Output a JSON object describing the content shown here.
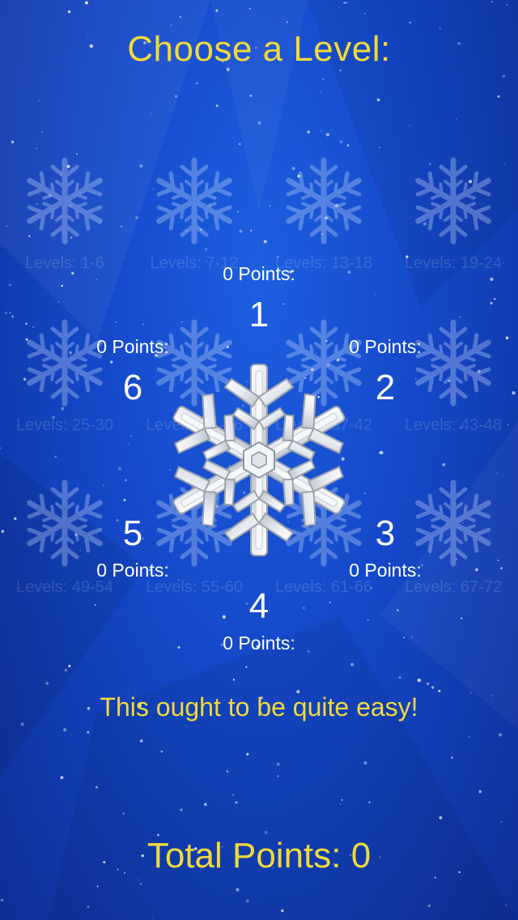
{
  "title": "Choose a Level:",
  "level_groups": [
    "Levels: 1-6",
    "Levels: 7-12",
    "Levels: 13-18",
    "Levels: 19-24",
    "Levels: 25-30",
    "Levels: 31-36",
    "Levels: 37-42",
    "Levels: 43-48",
    "Levels: 49-54",
    "Levels: 55-60",
    "Levels: 61-66",
    "Levels: 67-72"
  ],
  "levels": [
    {
      "number": "1",
      "points": "0 Points:"
    },
    {
      "number": "2",
      "points": "0 Points:"
    },
    {
      "number": "3",
      "points": "0 Points:"
    },
    {
      "number": "4",
      "points": "0 Points:"
    },
    {
      "number": "5",
      "points": "0 Points:"
    },
    {
      "number": "6",
      "points": "0 Points:"
    }
  ],
  "hint": "This ought to be quite easy!",
  "total_points": "Total Points: 0",
  "colors": {
    "accent_yellow": "#f2d93a",
    "background_blue": "#1548c9",
    "text_white": "#ffffff"
  },
  "icons": {
    "center": "snowflake-icon",
    "background": "snowflake-icon"
  }
}
